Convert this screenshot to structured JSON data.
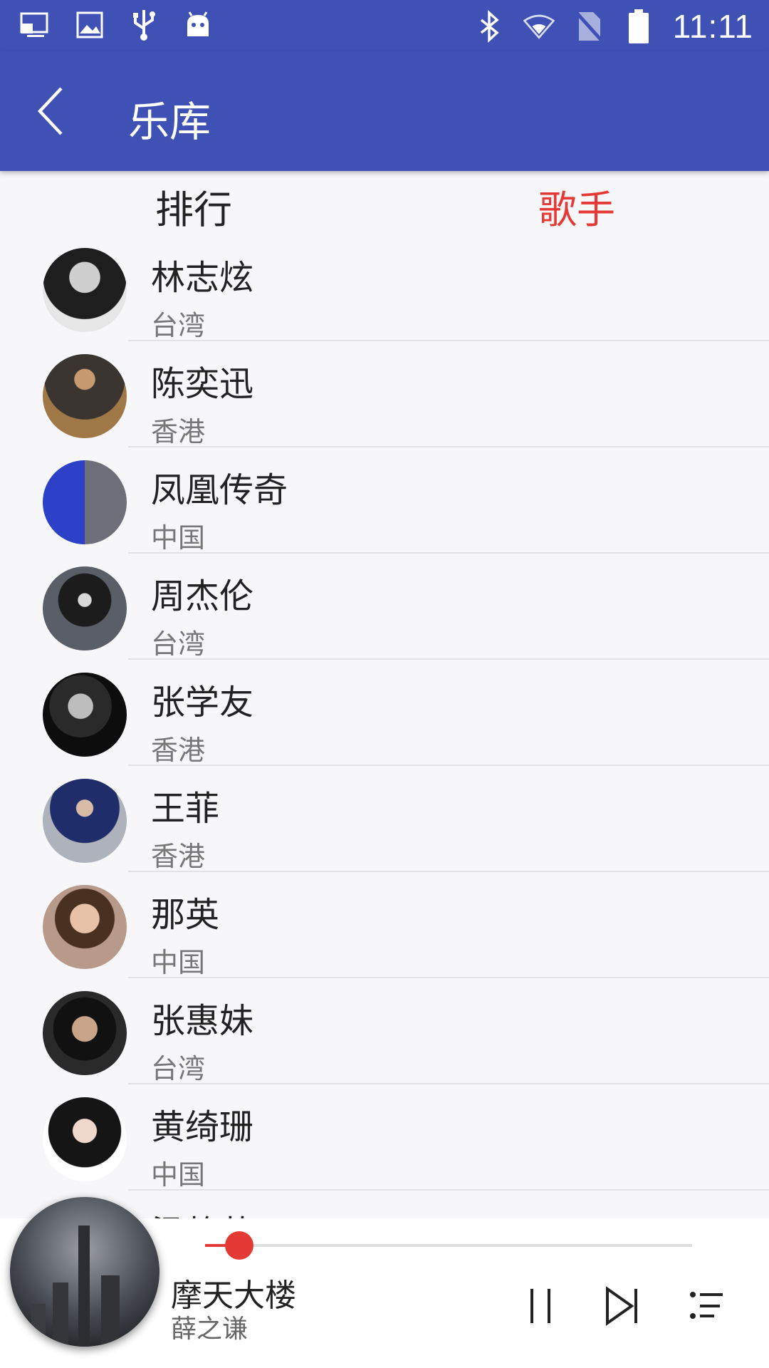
{
  "status_bar": {
    "time": "11:11",
    "left_icons": [
      "screen-cast-icon",
      "image-icon",
      "usb-icon",
      "android-icon"
    ],
    "right_icons": [
      "bluetooth-icon",
      "wifi-icon",
      "no-sim-icon",
      "battery-icon"
    ]
  },
  "app_bar": {
    "title": "乐库",
    "back_icon": "chevron-left-icon"
  },
  "tabs": [
    {
      "label": "排行",
      "active": false
    },
    {
      "label": "歌手",
      "active": true
    }
  ],
  "artists": [
    {
      "name": "林志炫",
      "region": "台湾"
    },
    {
      "name": "陈奕迅",
      "region": "香港"
    },
    {
      "name": "凤凰传奇",
      "region": "中国"
    },
    {
      "name": "周杰伦",
      "region": "台湾"
    },
    {
      "name": "张学友",
      "region": "香港"
    },
    {
      "name": "王菲",
      "region": "香港"
    },
    {
      "name": "那英",
      "region": "中国"
    },
    {
      "name": "张惠妹",
      "region": "台湾"
    },
    {
      "name": "黄绮珊",
      "region": "中国"
    },
    {
      "name": "梁静茹",
      "region": ""
    }
  ],
  "player": {
    "song_title": "摩天大楼",
    "artist": "薛之谦",
    "progress": 0.07,
    "controls": [
      "pause-icon",
      "skip-next-icon",
      "playlist-icon"
    ]
  },
  "colors": {
    "primary": "#3f51b5",
    "accent": "#e53935"
  }
}
